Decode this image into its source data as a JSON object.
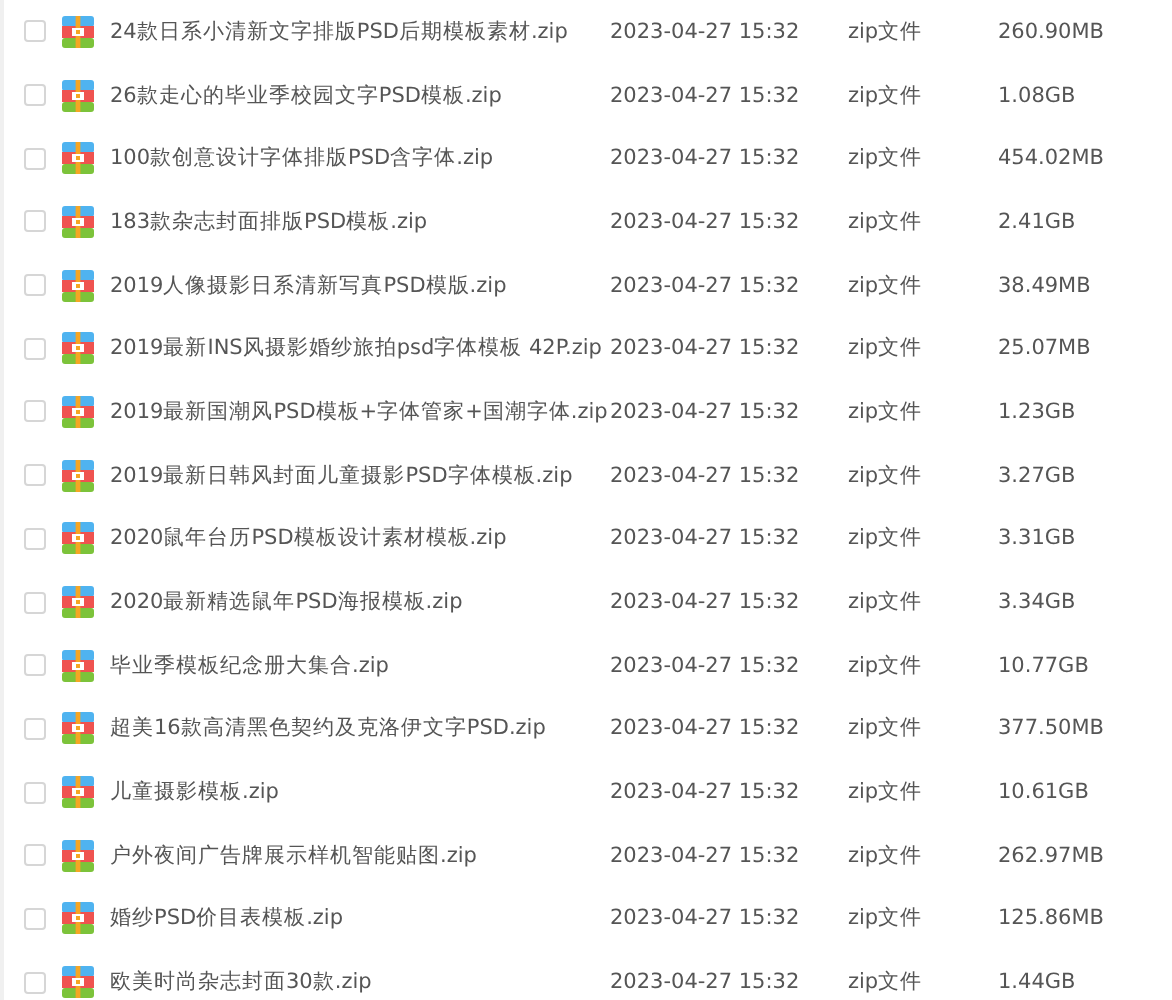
{
  "files": [
    {
      "name": "24款日系小清新文字排版PSD后期模板素材.zip",
      "checked": false,
      "date": "2023-04-27 15:32",
      "type": "zip文件",
      "size": "260.90MB"
    },
    {
      "name": "26款走心的毕业季校园文字PSD模板.zip",
      "checked": false,
      "date": "2023-04-27 15:32",
      "type": "zip文件",
      "size": "1.08GB"
    },
    {
      "name": "100款创意设计字体排版PSD含字体.zip",
      "checked": false,
      "date": "2023-04-27 15:32",
      "type": "zip文件",
      "size": "454.02MB"
    },
    {
      "name": "183款杂志封面排版PSD模板.zip",
      "checked": false,
      "date": "2023-04-27 15:32",
      "type": "zip文件",
      "size": "2.41GB"
    },
    {
      "name": "2019人像摄影日系清新写真PSD模版.zip",
      "checked": false,
      "date": "2023-04-27 15:32",
      "type": "zip文件",
      "size": "38.49MB"
    },
    {
      "name": "2019最新INS风摄影婚纱旅拍psd字体模板 42P.zip",
      "checked": false,
      "date": "2023-04-27 15:32",
      "type": "zip文件",
      "size": "25.07MB"
    },
    {
      "name": "2019最新国潮风PSD模板+字体管家+国潮字体.zip",
      "checked": false,
      "date": "2023-04-27 15:32",
      "type": "zip文件",
      "size": "1.23GB"
    },
    {
      "name": "2019最新日韩风封面儿童摄影PSD字体模板.zip",
      "checked": false,
      "date": "2023-04-27 15:32",
      "type": "zip文件",
      "size": "3.27GB"
    },
    {
      "name": "2020鼠年台历PSD模板设计素材模板.zip",
      "checked": false,
      "date": "2023-04-27 15:32",
      "type": "zip文件",
      "size": "3.31GB"
    },
    {
      "name": "2020最新精选鼠年PSD海报模板.zip",
      "checked": false,
      "date": "2023-04-27 15:32",
      "type": "zip文件",
      "size": "3.34GB"
    },
    {
      "name": "毕业季模板纪念册大集合.zip",
      "checked": false,
      "date": "2023-04-27 15:32",
      "type": "zip文件",
      "size": "10.77GB"
    },
    {
      "name": "超美16款高清黑色契约及克洛伊文字PSD.zip",
      "checked": false,
      "date": "2023-04-27 15:32",
      "type": "zip文件",
      "size": "377.50MB"
    },
    {
      "name": "儿童摄影模板.zip",
      "checked": false,
      "date": "2023-04-27 15:32",
      "type": "zip文件",
      "size": "10.61GB"
    },
    {
      "name": "户外夜间广告牌展示样机智能贴图.zip",
      "checked": false,
      "date": "2023-04-27 15:32",
      "type": "zip文件",
      "size": "262.97MB"
    },
    {
      "name": "婚纱PSD价目表模板.zip",
      "checked": false,
      "date": "2023-04-27 15:32",
      "type": "zip文件",
      "size": "125.86MB"
    },
    {
      "name": "欧美时尚杂志封面30款.zip",
      "checked": false,
      "date": "2023-04-27 15:32",
      "type": "zip文件",
      "size": "1.44GB"
    }
  ]
}
